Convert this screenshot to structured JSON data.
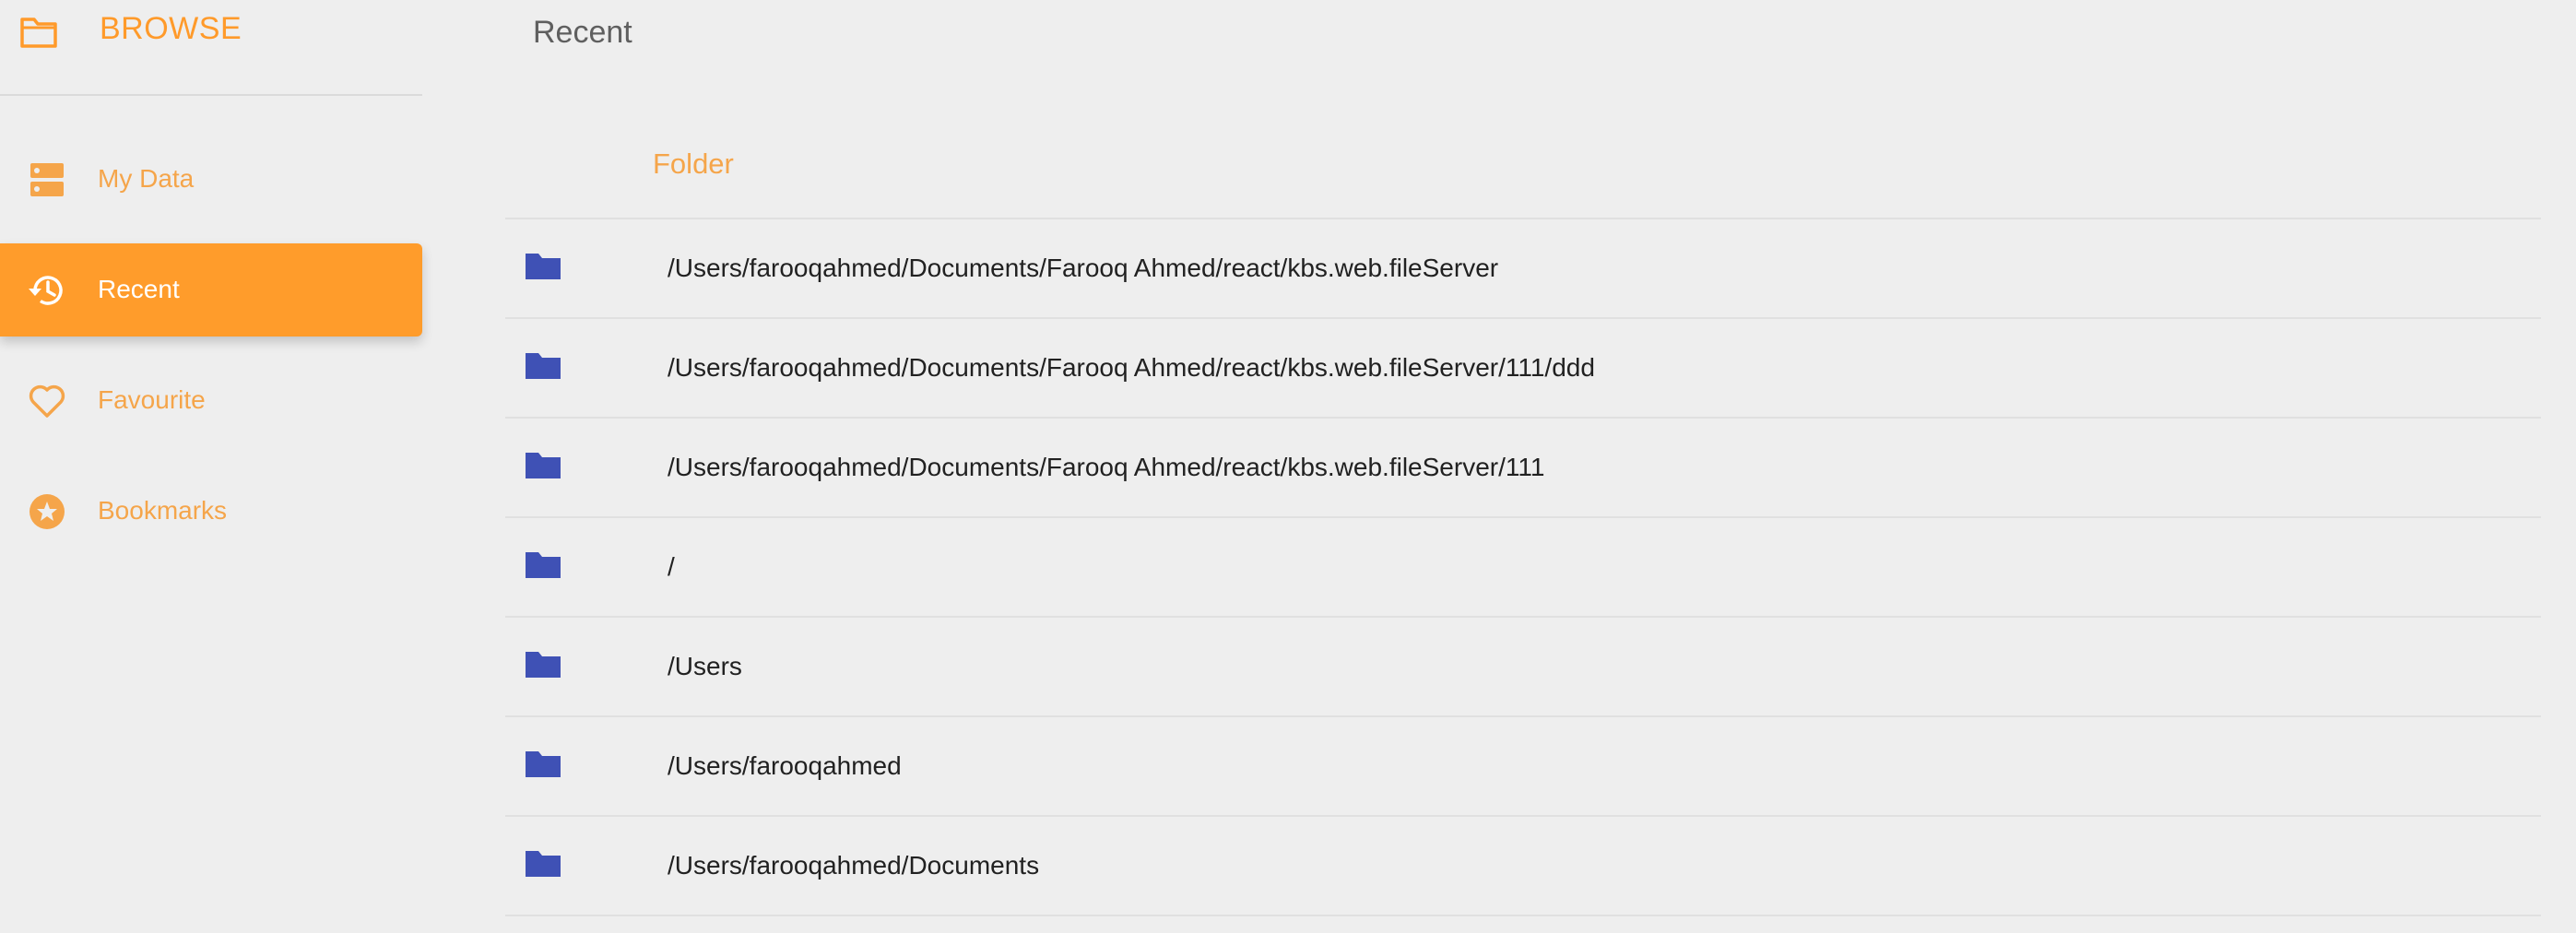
{
  "sidebar": {
    "brand": {
      "label": "BROWSE",
      "icon": "folder-outline-icon"
    },
    "items": [
      {
        "label": "My Data",
        "icon": "storage-icon",
        "active": false
      },
      {
        "label": "Recent",
        "icon": "history-icon",
        "active": true
      },
      {
        "label": "Favourite",
        "icon": "heart-outline-icon",
        "active": false
      },
      {
        "label": "Bookmarks",
        "icon": "star-circle-icon",
        "active": false
      }
    ]
  },
  "main": {
    "title": "Recent",
    "table": {
      "column_header": "Folder",
      "rows": [
        {
          "icon": "folder-icon",
          "path": "/Users/farooqahmed/Documents/Farooq Ahmed/react/kbs.web.fileServer"
        },
        {
          "icon": "folder-icon",
          "path": "/Users/farooqahmed/Documents/Farooq Ahmed/react/kbs.web.fileServer/111/ddd"
        },
        {
          "icon": "folder-icon",
          "path": "/Users/farooqahmed/Documents/Farooq Ahmed/react/kbs.web.fileServer/111"
        },
        {
          "icon": "folder-icon",
          "path": "/"
        },
        {
          "icon": "folder-icon",
          "path": "/Users"
        },
        {
          "icon": "folder-icon",
          "path": "/Users/farooqahmed"
        },
        {
          "icon": "folder-icon",
          "path": "/Users/farooqahmed/Documents"
        }
      ]
    }
  },
  "colors": {
    "accent": "#ff9c2b",
    "accent_text": "#f5a54a",
    "folder_icon": "#3f51b5",
    "background": "#eeeeee"
  }
}
